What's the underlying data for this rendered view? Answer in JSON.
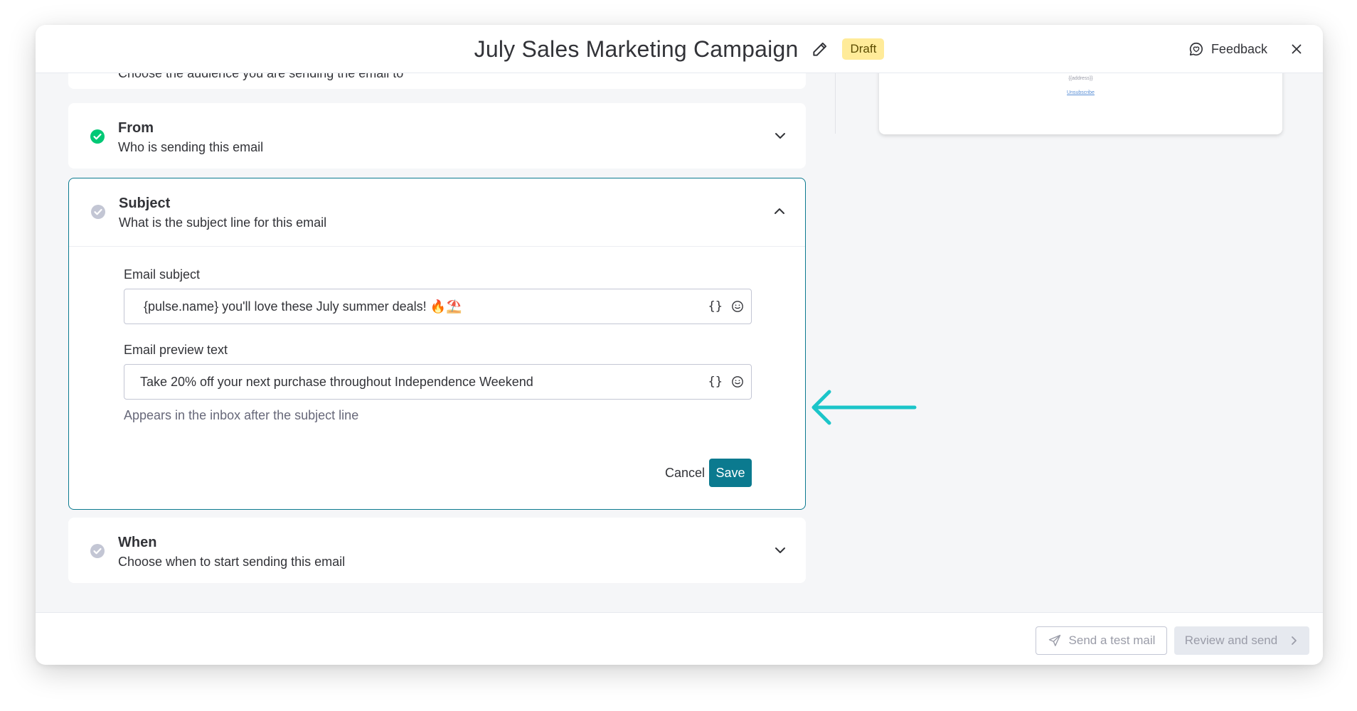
{
  "header": {
    "title": "July Sales Marketing Campaign",
    "status_badge": "Draft",
    "feedback_label": "Feedback",
    "icons": {
      "edit": "pencil-icon",
      "feedback": "chat-heart-icon",
      "close": "close-icon"
    }
  },
  "sections": {
    "audience": {
      "subtitle": "Choose the audience you are sending the email to"
    },
    "from": {
      "title": "From",
      "subtitle": "Who is sending this email",
      "status": "complete",
      "expanded": false
    },
    "subject": {
      "title": "Subject",
      "subtitle": "What is the subject line for this email",
      "status": "incomplete",
      "expanded": true,
      "email_subject_label": "Email subject",
      "email_subject_value": "{pulse.name} you'll love these July summer deals! 🔥⛱️",
      "email_preview_label": "Email preview text",
      "email_preview_value": "Take 20% off your next purchase throughout Independence Weekend",
      "preview_helper": "Appears in the inbox after the subject line",
      "variables_button": "{}",
      "cancel_label": "Cancel",
      "save_label": "Save"
    },
    "when": {
      "title": "When",
      "subtitle": "Choose when to start sending this email",
      "status": "incomplete",
      "expanded": false
    }
  },
  "preview": {
    "address_placeholder": "{{address}}",
    "unsubscribe_link": "Unsubscribe"
  },
  "footer": {
    "send_test_label": "Send a test mail",
    "review_send_label": "Review and send"
  },
  "colors": {
    "accent": "#0b7a8f",
    "complete_green": "#00c875",
    "incomplete_gray": "#c3c6d4",
    "draft_badge": "#ffeb99",
    "annotation_arrow": "#1bc5c9"
  }
}
